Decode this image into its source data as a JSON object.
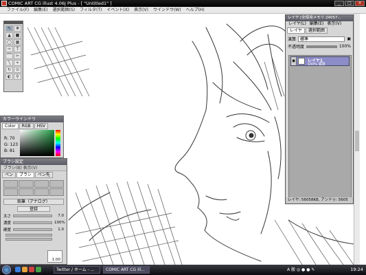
{
  "window": {
    "title": "COMIC ART CG illust 4.06J Plus - [ \"Untitled1\" ]"
  },
  "menu": [
    "ファイル(F)",
    "編集(E)",
    "選択範囲(S)",
    "フィルタ(T)",
    "イベント(X)",
    "表示(V)",
    "ウインドウ(W)",
    "ヘルプ(H)"
  ],
  "tools": [
    "✎",
    "✥",
    "▲",
    "■",
    "◯",
    "▦",
    "✑",
    "T",
    "⌒",
    "✂",
    "╲",
    "⌖",
    "↻",
    "⊙",
    "◐",
    "⚲"
  ],
  "color_window": {
    "title": "カラーウインドウ",
    "tabs": [
      "Color",
      "RGB",
      "HSV"
    ],
    "r_label": "R: 70",
    "g_label": "G: 123",
    "b_label": "B: 81"
  },
  "brush_window": {
    "title": "ブラシ設定",
    "menu": [
      "ブラシ(B)",
      "表示(V)"
    ],
    "tabs": [
      "ペン",
      "ブラシ",
      "ペン先"
    ],
    "preset_name": "鉛筆（アナログ）",
    "register_button": "登録",
    "sliders": [
      {
        "label": "太さ",
        "value": "7.0"
      },
      {
        "label": "濃度",
        "value": "100%"
      },
      {
        "label": "硬度",
        "value": "1.0"
      },
      {
        "label": "",
        "value": ""
      },
      {
        "label": "",
        "value": ""
      }
    ],
    "corner_value": "1.00"
  },
  "layer_window": {
    "title": "レイヤ [全使用メモリ 24057...",
    "menu": [
      "レイヤ(L)",
      "編集(E)",
      "表示(V)"
    ],
    "tabs": [
      "レイヤ",
      "選択範囲"
    ],
    "blend_label": "演算",
    "blend_value": "標準",
    "opacity_label": "不透明度",
    "opacity_value": "100%",
    "layers": [
      {
        "name": "レイヤ1",
        "sub": "100% 標準"
      }
    ],
    "status": "レイヤ: 56058KB, アンドゥ: 5605"
  },
  "taskbar": {
    "tasks": [
      "Twitter / ホーム - ...",
      "COMIC ART CG ill..."
    ],
    "tray_text": "A 般 ◎ ● ● ✎",
    "clock": "19:24",
    "quick_launch_colors": [
      "#3b7ddd",
      "#e8a13a",
      "#d04040",
      "#46a046"
    ]
  }
}
